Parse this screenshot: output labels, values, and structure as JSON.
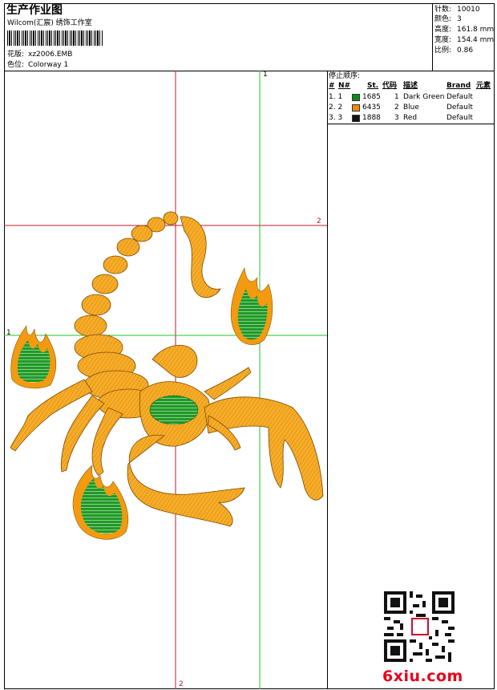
{
  "header": {
    "title": "生产作业图",
    "company": "Wilcom(汇宸) 绣饰工作室",
    "design_label": "花版:",
    "design_value": "xz2006.EMB",
    "colorway_label": "色位:",
    "colorway_value": "Colorway 1"
  },
  "stats": [
    {
      "label": "针数:",
      "value": "10010"
    },
    {
      "label": "颜色:",
      "value": "3"
    },
    {
      "label": "高度:",
      "value": "161.8 mm"
    },
    {
      "label": "宽度:",
      "value": "154.4 mm"
    },
    {
      "label": "比例:",
      "value": "0.86"
    }
  ],
  "stop_sequence": {
    "title": "停止顺序:",
    "columns": [
      "#",
      "N#",
      "St.",
      "代码",
      "描述",
      "Brand",
      "元素"
    ],
    "rows": [
      {
        "index": "1. 1",
        "st": "1685",
        "code": "1",
        "desc": "Dark Green",
        "brand": "Default",
        "color": "#0f8a1e"
      },
      {
        "index": "2. 2",
        "st": "6435",
        "code": "2",
        "desc": "Blue",
        "brand": "Default",
        "color": "#f08a10"
      },
      {
        "index": "3. 3",
        "st": "1888",
        "code": "3",
        "desc": "Red",
        "brand": "Default",
        "color": "#111111"
      }
    ]
  },
  "guides": {
    "green_top": "1",
    "green_left": "1",
    "red_right": "2",
    "red_bottom": "2"
  },
  "colors": {
    "orange": "#f39a10",
    "green": "#1d8f1d",
    "red_guide": "#c0182a",
    "green_guide": "#22c522"
  },
  "watermark": "6xiu.com"
}
